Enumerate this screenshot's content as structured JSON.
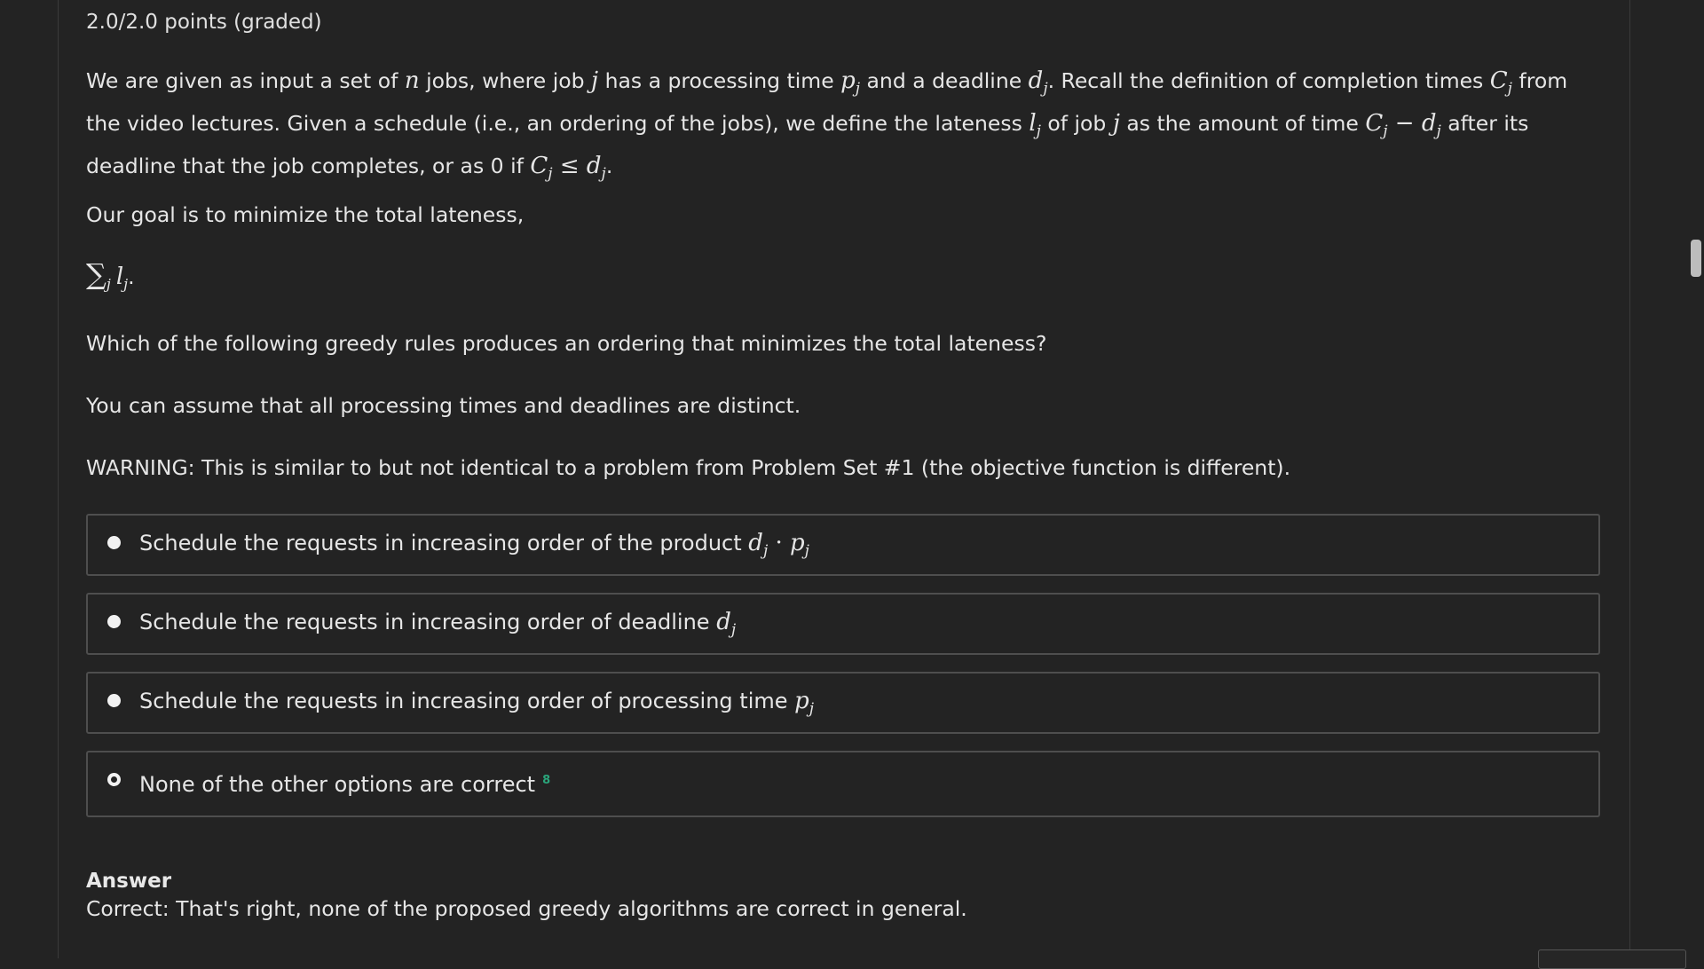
{
  "header": {
    "points": "2.0/2.0 points (graded)"
  },
  "problem": {
    "p1": {
      "a": "We are given as input a set of ",
      "n": "n",
      "b": " jobs, where job ",
      "j1": "j",
      "c": " has a processing time ",
      "pj": "p",
      "pj_sub": "j",
      "d": " and a deadline ",
      "dj": "d",
      "dj_sub": "j",
      "e": ". Recall the definition of completion times ",
      "Cj": "C",
      "Cj_sub": "j",
      "f": " from the video lectures. Given a schedule (i.e., an ordering of the jobs), we define the lateness ",
      "lj": "l",
      "lj_sub": "j",
      "g": " of job ",
      "j2": "j",
      "h": " as the amount of time ",
      "Cj2": "C",
      "Cj2_sub": "j",
      "minus": " − ",
      "dj2": "d",
      "dj2_sub": "j",
      "i": " after its deadline that the job completes, or as 0 if ",
      "Cj3": "C",
      "Cj3_sub": "j",
      "le": " ≤ ",
      "dj3": "d",
      "dj3_sub": "j",
      "end": "."
    },
    "p2": "Our goal is to minimize the total lateness,",
    "formula": {
      "sum": "∑",
      "sum_sub": "j",
      "l": "l",
      "l_sub": "j",
      "dot": "."
    },
    "p3": "Which of the following greedy rules produces an ordering that minimizes the total lateness?",
    "p4": "You can assume that all processing times and deadlines are distinct.",
    "p5": "WARNING: This is similar to but not identical to a problem from Problem Set #1 (the objective function is different)."
  },
  "options": [
    {
      "text": "Schedule the requests in increasing order of the product ",
      "m1": "d",
      "m1_sub": "j",
      "op": " · ",
      "m2": "p",
      "m2_sub": "j",
      "selected": false
    },
    {
      "text": "Schedule the requests in increasing order of deadline ",
      "m1": "d",
      "m1_sub": "j",
      "selected": false
    },
    {
      "text": "Schedule the requests in increasing order of processing time ",
      "m1": "p",
      "m1_sub": "j",
      "selected": false
    },
    {
      "text": "None of the other options are correct",
      "mark": "8",
      "selected": true
    }
  ],
  "answer": {
    "title": "Answer",
    "text": "Correct:  That's right, none of the proposed greedy algorithms are correct in general."
  },
  "colors": {
    "background": "#232323",
    "text": "#e6e6e6",
    "border": "#4e4e4e",
    "correct": "#2aa57b"
  }
}
